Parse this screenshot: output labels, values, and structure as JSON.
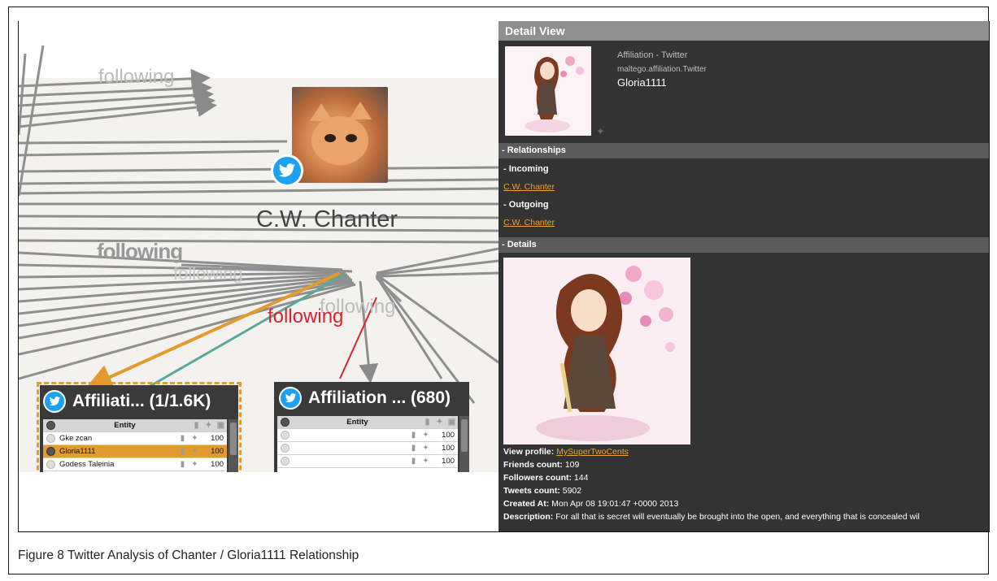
{
  "graph": {
    "central_entity": "C.W. Chanter",
    "edge_labels": {
      "top": "following",
      "left_bold": "following",
      "left_faded": "following",
      "red": "following",
      "grey": "following"
    }
  },
  "affiliation_boxes": [
    {
      "title": "Affiliati... (1/1.6K)",
      "header": "Entity",
      "rows": [
        {
          "name": "Gke zcan",
          "value": "100",
          "selected": false
        },
        {
          "name": "Gloria1111",
          "value": "100",
          "selected": true
        },
        {
          "name": "Godess Taleinia",
          "value": "100",
          "selected": false
        }
      ]
    },
    {
      "title": "Affiliation ... (680)",
      "header": "Entity",
      "rows": [
        {
          "name": "",
          "value": "100",
          "selected": false
        },
        {
          "name": "",
          "value": "100",
          "selected": false
        },
        {
          "name": "",
          "value": "100",
          "selected": false
        }
      ]
    }
  ],
  "detail_view": {
    "title": "Detail View",
    "entity_type": "Affiliation - Twitter",
    "entity_class": "maltego.affiliation.Twitter",
    "entity_name": "Gloria1111",
    "relationships": {
      "section": "- Relationships",
      "incoming_label": "- Incoming",
      "incoming_link": "C.W. Chanter",
      "outgoing_label": "- Outgoing",
      "outgoing_link": "C.W. Chanter"
    },
    "details": {
      "section": "- Details",
      "view_profile_label": "View profile:",
      "view_profile_link": "MySuperTwoCents",
      "friends_label": "Friends count:",
      "friends_value": "109",
      "followers_label": "Followers count:",
      "followers_value": "144",
      "tweets_label": "Tweets count:",
      "tweets_value": "5902",
      "created_label": "Created At:",
      "created_value": "Mon Apr 08 19:01:47 +0000 2013",
      "description_label": "Description:",
      "description_value": "For all that is secret will eventually be brought into the open, and everything that is concealed wil"
    }
  },
  "caption": "Figure 8 Twitter Analysis of Chanter / Gloria1111 Relationship",
  "colors": {
    "twitter_blue": "#1da1f2",
    "accent_orange": "#e39a2e",
    "edge_teal": "#5aa89a",
    "edge_red": "#d9232e",
    "panel_dark": "#333333"
  },
  "icons": [
    "twitter-bird-icon",
    "bookmark-icon",
    "pin-icon",
    "image-icon"
  ]
}
